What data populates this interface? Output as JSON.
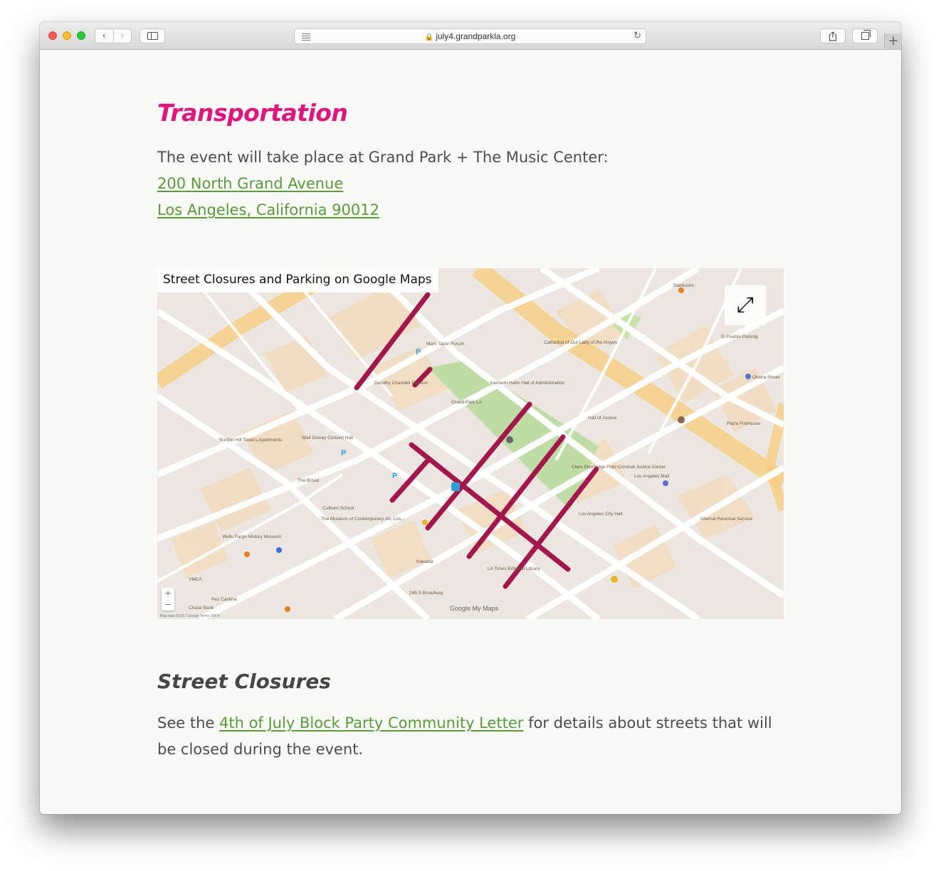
{
  "browser": {
    "url": "july4.grandparkla.org"
  },
  "transportation": {
    "heading": "Transportation",
    "intro": "The event will take place at Grand Park + The Music Center:",
    "address_line1": "200 North Grand Avenue",
    "address_line2": "Los Angeles, California 90012"
  },
  "map": {
    "title": "Street Closures and Parking on Google Maps",
    "labels": {
      "grand_park": "Grand Park LA",
      "music_center": "Mark Taper Forum",
      "dorothy": "Dorothy Chandler Pavilion",
      "disney": "Walt Disney Concert Hall",
      "broad": "The Broad",
      "city_hall": "Los Angeles City Hall",
      "hall_justice": "Hall of Justice",
      "cathedral": "Cathedral of Our Lady of the Angels",
      "kenneth": "Kenneth Hahn Hall of Administration",
      "colburn": "Colburn School",
      "moca": "The Museum of Contemporary Art, Los...",
      "wells_fargo": "Wells Fargo History Museum",
      "bunker_hill": "Bunker Hill Towers Apartments",
      "pueblo": "El Pueblo Parking",
      "olvera": "Olvera Street",
      "plaza_firehouse": "Plaza Firehouse",
      "la_mall": "Los Angeles Mall",
      "irs": "Internal Revenue Service",
      "la_times": "LA Times Editorial Library",
      "kawada": "Kawada",
      "starbucks": "Starbucks",
      "ymca": "YMCA",
      "pez": "Pez Cantina",
      "chase": "Chase Bank",
      "broadway245": "245 S Broadway",
      "foltz": "Clara Shortridge Foltz Criminal Justice Center"
    },
    "zoom_in": "+",
    "zoom_out": "−",
    "credit": "Map data ©2017 Google   Terms   200 ft",
    "logo": "Google My Maps"
  },
  "closures": {
    "heading": "Street Closures",
    "text_before": "See the ",
    "link": "4th of July Block Party Community Letter",
    "text_after": " for details about streets that will be closed during the event."
  }
}
